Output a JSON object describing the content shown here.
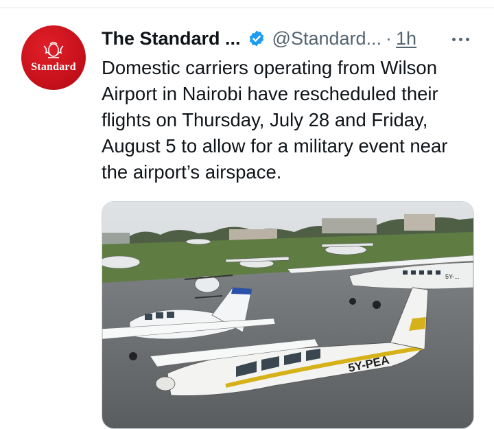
{
  "tweet": {
    "author_name": "The Standard ...",
    "handle": "@Standard...",
    "separator": "·",
    "time": "1h",
    "text": "Domestic carriers operating from Wilson Airport in Nairobi have rescheduled their flights on Thursday, July 28 and Friday, August 5 to allow for a military event near the airport’s airspace.",
    "verified": true
  },
  "avatar": {
    "brand_text": "Standard",
    "color": "#c8111b"
  },
  "media": {
    "registration_small": "5Y-...",
    "registration_large": "5Y-PEA"
  },
  "colors": {
    "verified": "#1d9bf0",
    "secondary_text": "#536471",
    "brand_red": "#c8111b"
  },
  "icons": [
    "verified-badge-icon",
    "more-options-icon"
  ]
}
